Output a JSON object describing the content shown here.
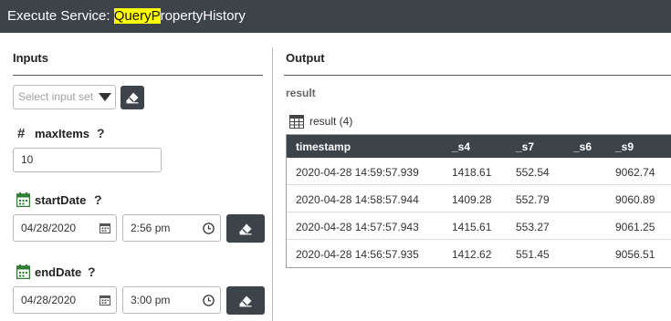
{
  "title": {
    "prefix": "Execute Service: ",
    "highlight": "QueryP",
    "suffix": "ropertyHistory"
  },
  "inputs": {
    "heading": "Inputs",
    "input_set_placeholder": "Select input set",
    "fields": {
      "maxItems": {
        "label": "maxItems",
        "help": "?",
        "value": "10"
      },
      "startDate": {
        "label": "startDate",
        "help": "?",
        "date": "04/28/2020",
        "time": "2:56 pm"
      },
      "endDate": {
        "label": "endDate",
        "help": "?",
        "date": "04/28/2020",
        "time": "3:00 pm"
      }
    }
  },
  "output": {
    "heading": "Output",
    "subheading": "result",
    "result_caption": "result (4)",
    "columns": [
      "timestamp",
      "_s4",
      "_s7",
      "_s6",
      "_s9"
    ],
    "rows": [
      [
        "2020-04-28 14:59:57.939",
        "1418.61",
        "552.54",
        "",
        "9062.74"
      ],
      [
        "2020-04-28 14:58:57.944",
        "1409.28",
        "552.79",
        "",
        "9060.89"
      ],
      [
        "2020-04-28 14:57:57.943",
        "1415.61",
        "553.27",
        "",
        "9061.25"
      ],
      [
        "2020-04-28 14:56:57.935",
        "1412.62",
        "551.45",
        "",
        "9056.51"
      ]
    ]
  },
  "colors": {
    "header_bg": "#3d4449",
    "highlight": "#ffff00",
    "calendar_icon": "#2e7d32"
  },
  "icons": [
    "eraser-icon",
    "hash-icon",
    "calendar-icon",
    "clock-icon",
    "table-icon",
    "chevron-down-icon"
  ]
}
